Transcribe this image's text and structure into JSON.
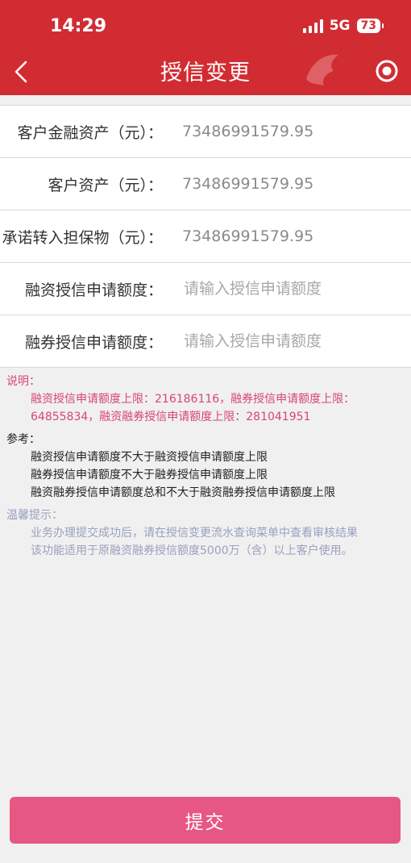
{
  "status_bar": {
    "time": "14:29",
    "network": "5G",
    "battery": "73"
  },
  "nav": {
    "title": "授信变更"
  },
  "form": {
    "rows": [
      {
        "label": "客户金融资产（元）：",
        "value": "73486991579.95"
      },
      {
        "label": "客户资产（元）：",
        "value": "73486991579.95"
      },
      {
        "label": "承诺转入担保物（元）：",
        "value": "73486991579.95"
      },
      {
        "label": "融资授信申请额度：",
        "placeholder": "请输入授信申请额度"
      },
      {
        "label": "融券授信申请额度：",
        "placeholder": "请输入授信申请额度"
      }
    ]
  },
  "notes": {
    "explain_title": "说明：",
    "explain_lines": [
      "融资授信申请额度上限：216186116，融券授信申请额度上限：",
      "64855834，融资融券授信申请额度上限：281041951"
    ],
    "reference_title": "参考：",
    "reference_lines": [
      "融资授信申请额度不大于融资授信申请额度上限",
      "融券授信申请额度不大于融券授信申请额度上限",
      "融资融券授信申请额度总和不大于融资融券授信申请额度上限"
    ],
    "tips_title": "温馨提示：",
    "tips_lines": [
      "业务办理提交成功后，请在授信变更流水查询菜单中查看审核结果",
      "该功能适用于原融资融券授信额度5000万（含）以上客户使用。"
    ]
  },
  "submit": {
    "label": "提交"
  },
  "colors": {
    "header": "#d22c33",
    "button": "#e65883",
    "explain_text": "#d8447a",
    "tips_text": "#9aa0c0"
  }
}
